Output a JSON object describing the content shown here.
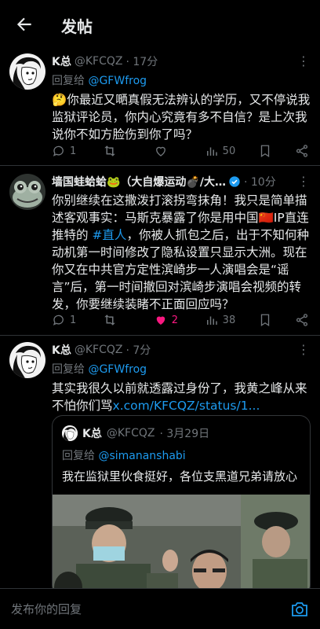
{
  "header": {
    "title": "发帖"
  },
  "tweets": [
    {
      "name": "K总",
      "handle": "@KFCQZ",
      "time": "· 17分",
      "reply_prefix": "回复给 ",
      "reply_to": "@GFWfrog",
      "text": "🤔你最近又嗮真假无法辨认的学历，又不停说我监狱评论员，你内心究竟有多不自信？是上次我说你不如方脸伤到你了吗？",
      "replies": "1",
      "retweets": "",
      "likes": "",
      "views": "50"
    },
    {
      "name": "墙国蛙蛤蛤🐸（大自爆运动💣/大…",
      "handle": "",
      "time": "· 10分",
      "text_before": "你别继续在这撒泼打滚拐弯抹角！我只是简单描述客观事实：马斯克暴露了你是用中国🇨🇳IP直连推特的 ",
      "text_link": "#直人",
      "text_after": "，你被人抓包之后，出于不知何种动机第一时间修改了隐私设置只显示大洲。现在你又在中共官方定性滨崎步一人演唱会是“谣言”后，第一时间撤回对滨崎步演唱会视频的转发，你要继续装睹不正面回应吗？",
      "replies": "1",
      "retweets": "",
      "likes": "2",
      "views": "38"
    },
    {
      "name": "K总",
      "handle": "@KFCQZ",
      "time": "· 7分",
      "reply_prefix": "回复给 ",
      "reply_to": "@GFWfrog",
      "text": "其实我很久以前就透露过身份了，我黄之峰从来不怕你们骂",
      "text_link": "x.com/KFCQZ/status/1..."
    }
  ],
  "quote": {
    "name": "K总",
    "handle": "@KFCQZ",
    "time": "· 3月29日",
    "reply_prefix": "回复给 ",
    "reply_to": "@simananshabi",
    "text": "我在监狱里伙食挺好，各位支黑道兄弟请放心"
  },
  "composer": {
    "placeholder": "发布你的回复"
  },
  "colors": {
    "background": "#000000",
    "text": "#e7e9ea",
    "muted": "#71767b",
    "link": "#1d9bf0",
    "like": "#f91880",
    "verified": "#1d9bf0"
  }
}
